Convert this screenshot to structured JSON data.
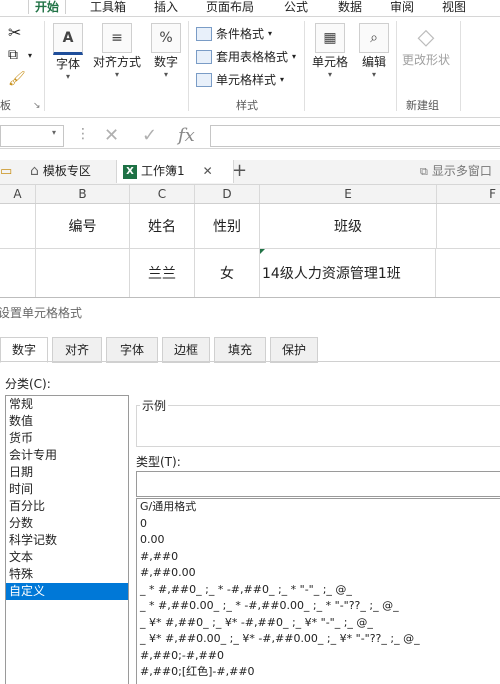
{
  "ribbon_tabs": [
    "开始",
    "工具箱",
    "插入",
    "页面布局",
    "公式",
    "数据",
    "审阅",
    "视图"
  ],
  "ribbon": {
    "font_label": "字体",
    "align_label": "对齐方式",
    "number_label": "数字",
    "conditional_format": "条件格式",
    "table_format": "套用表格格式",
    "cell_style": "单元格样式",
    "styles_group": "样式",
    "cells_label": "单元格",
    "edit_label": "编辑",
    "change_shape": "更改形状",
    "new_group": "新建组",
    "clipboard_group": "板"
  },
  "formula_bar": {
    "fx": "fx"
  },
  "workbook_tabs": {
    "template": "模板专区",
    "workbook": "工作簿1",
    "add": "+",
    "show_multi": "显示多窗口"
  },
  "grid": {
    "columns": [
      "A",
      "B",
      "C",
      "D",
      "E",
      "F"
    ],
    "header_row": [
      "编号",
      "姓名",
      "性别",
      "班级"
    ],
    "data_row": [
      "兰兰",
      "女",
      "14级人力资源管理1班"
    ]
  },
  "dialog": {
    "title": "设置单元格格式",
    "tabs": [
      "数字",
      "对齐",
      "字体",
      "边框",
      "填充",
      "保护"
    ],
    "category_label": "分类(C):",
    "categories": [
      "常规",
      "数值",
      "货币",
      "会计专用",
      "日期",
      "时间",
      "百分比",
      "分数",
      "科学记数",
      "文本",
      "特殊",
      "自定义"
    ],
    "selected_category": "自定义",
    "sample_label": "示例",
    "type_label": "类型(T):",
    "type_value": "",
    "formats": [
      "G/通用格式",
      "0",
      "0.00",
      "#,##0",
      "#,##0.00",
      "_ * #,##0_ ;_ * -#,##0_ ;_ * \"-\"_ ;_ @_",
      "_ * #,##0.00_ ;_ * -#,##0.00_ ;_ * \"-\"??_ ;_ @_",
      "_ ¥* #,##0_ ;_ ¥* -#,##0_ ;_ ¥* \"-\"_ ;_ @_",
      "_ ¥* #,##0.00_ ;_ ¥* -#,##0.00_ ;_ ¥* \"-\"??_ ;_ @_",
      "#,##0;-#,##0",
      "#,##0;[红色]-#,##0"
    ]
  },
  "colors": {
    "accent": "#217346",
    "selection": "#0078d7",
    "excel_green": "#1e7145"
  }
}
